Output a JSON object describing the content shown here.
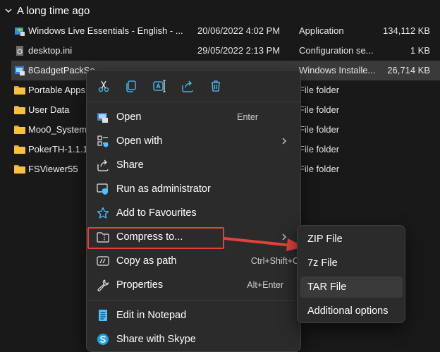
{
  "group": {
    "title": "A long time ago"
  },
  "files": [
    {
      "name": "Windows Live Essentials - English - ...",
      "date": "20/06/2022 4:02 PM",
      "type": "Application",
      "size": "134,112 KB",
      "icon": "installer-icon"
    },
    {
      "name": "desktop.ini",
      "date": "29/05/2022 2:13 PM",
      "type": "Configuration se...",
      "size": "1 KB",
      "icon": "settings-file-icon"
    },
    {
      "name": "8GadgetPackSe",
      "date": "",
      "type": "Windows Installe...",
      "size": "26,714 KB",
      "icon": "msi-icon"
    },
    {
      "name": "Portable Apps",
      "date": "",
      "type": "File folder",
      "size": "",
      "icon": "folder-icon"
    },
    {
      "name": "User Data",
      "date": "",
      "type": "File folder",
      "size": "",
      "icon": "folder-icon"
    },
    {
      "name": "Moo0_System",
      "date": "",
      "type": "File folder",
      "size": "",
      "icon": "folder-icon"
    },
    {
      "name": "PokerTH-1.1.1",
      "date": "",
      "type": "File folder",
      "size": "",
      "icon": "folder-icon"
    },
    {
      "name": "FSViewer55",
      "date": "",
      "type": "File folder",
      "size": "",
      "icon": "folder-icon"
    }
  ],
  "context_menu": {
    "quick_actions": [
      "cut-icon",
      "copy-icon",
      "rename-icon",
      "share-icon",
      "delete-icon"
    ],
    "items": [
      {
        "label": "Open",
        "shortcut": "Enter",
        "icon": "open-icon"
      },
      {
        "label": "Open with",
        "shortcut": "",
        "icon": "open-with-icon"
      },
      {
        "label": "Share",
        "shortcut": "",
        "icon": "share-icon"
      },
      {
        "label": "Run as administrator",
        "shortcut": "",
        "icon": "shield-icon"
      },
      {
        "label": "Add to Favourites",
        "shortcut": "",
        "icon": "star-icon"
      },
      {
        "label": "Compress to...",
        "shortcut": "",
        "icon": "zip-folder-icon"
      },
      {
        "label": "Copy as path",
        "shortcut": "Ctrl+Shift+C",
        "icon": "path-icon"
      },
      {
        "label": "Properties",
        "shortcut": "Alt+Enter",
        "icon": "wrench-icon"
      },
      {
        "label": "Edit in Notepad",
        "shortcut": "",
        "icon": "notepad-icon"
      },
      {
        "label": "Share with Skype",
        "shortcut": "",
        "icon": "skype-icon"
      }
    ]
  },
  "submenu": {
    "items": [
      {
        "label": "ZIP File"
      },
      {
        "label": "7z File"
      },
      {
        "label": "TAR File"
      },
      {
        "label": "Additional options"
      }
    ]
  },
  "colors": {
    "background": "#191919",
    "menu_bg": "#2b2b2b",
    "highlight": "#e0433b",
    "folder": "#f6c042",
    "accent": "#4cc2ff"
  }
}
